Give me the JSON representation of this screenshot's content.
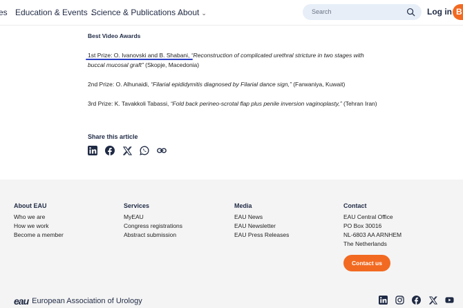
{
  "header": {
    "nav": [
      {
        "label": "es"
      },
      {
        "label": "Education & Events"
      },
      {
        "label": "Science & Publications"
      },
      {
        "label": "About"
      }
    ],
    "search_placeholder": "Search",
    "login_label": "Log in",
    "pill_label": "B"
  },
  "article": {
    "section_title": "Best Video Awards",
    "prizes": [
      {
        "prefix": "1st Prize: O. Ivanovski and B. Shabani, ",
        "title": "“Reconstruction of complicated urethral stricture in two stages with buccal mucosal graft”",
        "suffix": " (Skopje, Macedonia)"
      },
      {
        "prefix": "2nd Prize: O. Alhunaidi, ",
        "title": "“Filarial epididymitis diagnosed by Filarial dance sign,”",
        "suffix": " (Farwaniya, Kuwait)"
      },
      {
        "prefix": "3rd Prize: K. Tavakkoli Tabassi, ",
        "title": "“Fold back perineo-scrotal flap plus penile inversion vaginoplasty,”",
        "suffix": " (Tehran Iran)"
      }
    ],
    "share_title": "Share this article"
  },
  "footer": {
    "columns": [
      {
        "heading": "About EAU",
        "links": [
          "Who we are",
          "How we work",
          "Become a member"
        ]
      },
      {
        "heading": "Services",
        "links": [
          "MyEAU",
          "Congress registrations",
          "Abstract submission"
        ]
      },
      {
        "heading": "Media",
        "links": [
          "EAU News",
          "EAU Newsletter",
          "EAU Press Releases"
        ]
      },
      {
        "heading": "Contact",
        "lines": [
          "EAU Central Office",
          "PO Box 30016",
          "NL-6803 AA ARNHEM",
          "The Netherlands"
        ]
      }
    ],
    "contact_button": "Contact us",
    "logo_mark": "eau",
    "org_name": "European Association of Urology"
  },
  "colors": {
    "accent": "#f26a21",
    "navy": "#1f2a44",
    "underline": "#2b3fc4"
  }
}
